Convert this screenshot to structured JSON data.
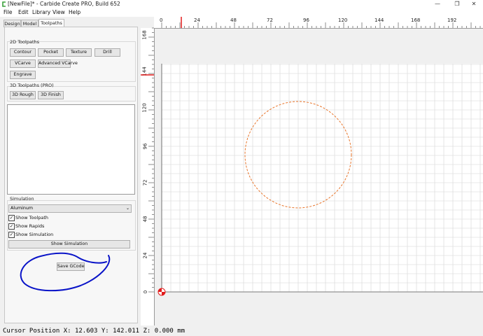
{
  "window": {
    "title": "[NewFile]* - Carbide Create PRO, Build 652",
    "minimize": "—",
    "restore": "❐",
    "close": "✕"
  },
  "menu": [
    "File",
    "Edit",
    "Library",
    "View",
    "Help"
  ],
  "tabs": [
    "Design",
    "Model",
    "Toolpaths"
  ],
  "toolpaths_2d": {
    "title": "2D Toolpaths",
    "buttons": [
      "Contour",
      "Pocket",
      "Texture",
      "Drill",
      "VCarve",
      "Advanced VCarve",
      "Engrave"
    ]
  },
  "toolpaths_3d": {
    "title": "3D Toolpaths (PRO)",
    "buttons": [
      "3D Rough",
      "3D Finish"
    ]
  },
  "simulation": {
    "title": "Simulation",
    "material": "Aluminum",
    "show_toolpath": "Show Toolpath",
    "show_rapids": "Show Rapids",
    "show_simulation_check": "Show Simulation",
    "show_simulation_button": "Show Simulation",
    "checkmark": "✓"
  },
  "save_gcode": "Save GCode",
  "status": {
    "text": "Cursor Position X: 12.603 Y: 142.011 Z: 0.000 mm"
  },
  "rulers": {
    "top": [
      "0",
      "24",
      "48",
      "72",
      "96",
      "120",
      "144",
      "168",
      "192"
    ],
    "left": [
      "168",
      "144",
      "120",
      "96",
      "72",
      "48",
      "24",
      "0"
    ]
  },
  "colors": {
    "circle": "#e8762c",
    "annotation": "#0a14c8",
    "origin": "#e21b1b",
    "marker": "#e21b1b"
  }
}
